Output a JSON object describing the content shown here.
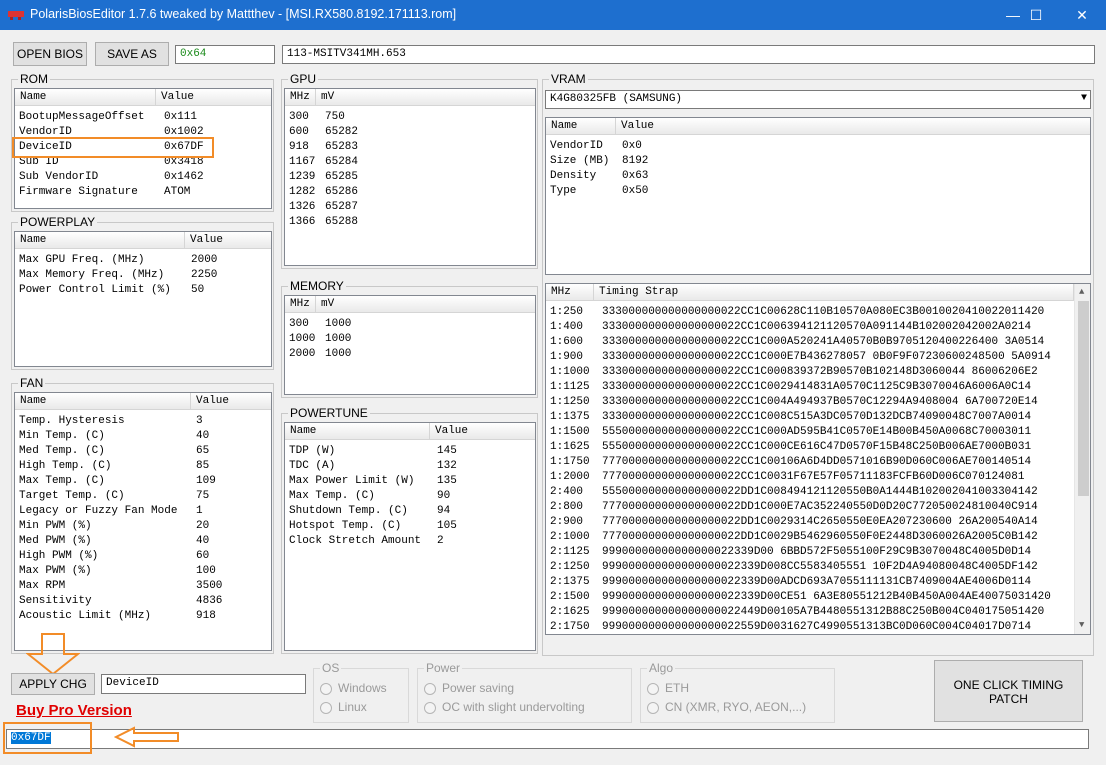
{
  "window": {
    "title": "PolarisBiosEditor 1.7.6 tweaked by Mattthev  -  [MSI.RX580.8192.171113.rom]",
    "minimize": "—",
    "maximize": "☐",
    "close": "✕"
  },
  "toolbar": {
    "open_label": "OPEN BIOS",
    "save_label": "SAVE AS",
    "checksum_value": "0x64",
    "part_number": "113-MSITV341MH.653"
  },
  "rom": {
    "label": "ROM",
    "col_name": "Name",
    "col_value": "Value",
    "rows": [
      {
        "name": "BootupMessageOffset",
        "value": "0x111"
      },
      {
        "name": "VendorID",
        "value": "0x1002"
      },
      {
        "name": "DeviceID",
        "value": "0x67DF"
      },
      {
        "name": "Sub ID",
        "value": "0x3418"
      },
      {
        "name": "Sub VendorID",
        "value": "0x1462"
      },
      {
        "name": "Firmware Signature",
        "value": "ATOM"
      }
    ]
  },
  "powerplay": {
    "label": "POWERPLAY",
    "col_name": "Name",
    "col_value": "Value",
    "rows": [
      {
        "name": "Max GPU Freq. (MHz)",
        "value": "2000"
      },
      {
        "name": "Max Memory Freq. (MHz)",
        "value": "2250"
      },
      {
        "name": "Power Control Limit (%)",
        "value": "50"
      }
    ]
  },
  "fan": {
    "label": "FAN",
    "col_name": "Name",
    "col_value": "Value",
    "rows": [
      {
        "name": "Temp. Hysteresis",
        "value": "3"
      },
      {
        "name": "Min Temp. (C)",
        "value": "40"
      },
      {
        "name": "Med Temp. (C)",
        "value": "65"
      },
      {
        "name": "High Temp. (C)",
        "value": "85"
      },
      {
        "name": "Max Temp. (C)",
        "value": "109"
      },
      {
        "name": "Target Temp. (C)",
        "value": "75"
      },
      {
        "name": "Legacy or Fuzzy Fan Mode",
        "value": "1"
      },
      {
        "name": "Min PWM (%)",
        "value": "20"
      },
      {
        "name": "Med PWM (%)",
        "value": "40"
      },
      {
        "name": "High PWM (%)",
        "value": "60"
      },
      {
        "name": "Max PWM (%)",
        "value": "100"
      },
      {
        "name": "Max RPM",
        "value": "3500"
      },
      {
        "name": "Sensitivity",
        "value": "4836"
      },
      {
        "name": "Acoustic Limit (MHz)",
        "value": "918"
      }
    ]
  },
  "gpu": {
    "label": "GPU",
    "col_mhz": "MHz",
    "col_mv": "mV",
    "rows": [
      {
        "mhz": "300",
        "mv": "750"
      },
      {
        "mhz": "600",
        "mv": "65282"
      },
      {
        "mhz": "918",
        "mv": "65283"
      },
      {
        "mhz": "1167",
        "mv": "65284"
      },
      {
        "mhz": "1239",
        "mv": "65285"
      },
      {
        "mhz": "1282",
        "mv": "65286"
      },
      {
        "mhz": "1326",
        "mv": "65287"
      },
      {
        "mhz": "1366",
        "mv": "65288"
      }
    ]
  },
  "memory": {
    "label": "MEMORY",
    "col_mhz": "MHz",
    "col_mv": "mV",
    "rows": [
      {
        "mhz": "300",
        "mv": "1000"
      },
      {
        "mhz": "1000",
        "mv": "1000"
      },
      {
        "mhz": "2000",
        "mv": "1000"
      }
    ]
  },
  "powertune": {
    "label": "POWERTUNE",
    "col_name": "Name",
    "col_value": "Value",
    "rows": [
      {
        "name": "TDP (W)",
        "value": "145"
      },
      {
        "name": "TDC (A)",
        "value": "132"
      },
      {
        "name": "Max Power Limit (W)",
        "value": "135"
      },
      {
        "name": "Max Temp. (C)",
        "value": "90"
      },
      {
        "name": "Shutdown Temp. (C)",
        "value": "94"
      },
      {
        "name": "Hotspot Temp. (C)",
        "value": "105"
      },
      {
        "name": "Clock Stretch Amount",
        "value": "2"
      }
    ]
  },
  "vram": {
    "label": "VRAM",
    "selected": "K4G80325FB (SAMSUNG)",
    "col_name": "Name",
    "col_value": "Value",
    "rows": [
      {
        "name": "VendorID",
        "value": "0x0"
      },
      {
        "name": "Size (MB)",
        "value": "8192"
      },
      {
        "name": "Density",
        "value": "0x63"
      },
      {
        "name": "Type",
        "value": "0x50"
      }
    ],
    "timing_col_mhz": "MHz",
    "timing_col_strap": "Timing Strap",
    "timings": [
      {
        "mhz": "1:250",
        "strap": "333000000000000000022CC1C00628C110B10570A080EC3B0010020410022011420"
      },
      {
        "mhz": "1:400",
        "strap": "333000000000000000022CC1C006394121120570A091144B102002042002A0214"
      },
      {
        "mhz": "1:600",
        "strap": "333000000000000000022CC1C000A520241A40570B0B9705120400226400 3A0514"
      },
      {
        "mhz": "1:900",
        "strap": "333000000000000000022CC1C000E7B436278057 0B0F9F07230600248500 5A0914"
      },
      {
        "mhz": "1:1000",
        "strap": "333000000000000000022CC1C000839372B90570B102148D3060044 86006206E2"
      },
      {
        "mhz": "1:1125",
        "strap": "333000000000000000022CC1C0029414831A0570C1125C9B3070046A6006A0C14"
      },
      {
        "mhz": "1:1250",
        "strap": "333000000000000000022CC1C004A494937B0570C12294A9408004 6A700720E14"
      },
      {
        "mhz": "1:1375",
        "strap": "333000000000000000022CC1C008C515A3DC0570D132DCB74090048C7007A0014"
      },
      {
        "mhz": "1:1500",
        "strap": "555000000000000000022CC1C000AD595B41C0570E14B00B450A0068C70003011"
      },
      {
        "mhz": "1:1625",
        "strap": "555000000000000000022CC1C000CE616C47D0570F15B48C250B006AE7000B031"
      },
      {
        "mhz": "1:1750",
        "strap": "777000000000000000022CC1C00106A6D4DD0571016B90D060C006AE700140514"
      },
      {
        "mhz": "1:2000",
        "strap": "777000000000000000022CC1C0031F67E57F05711183FCFB60D006C070124081"
      },
      {
        "mhz": "2:400",
        "strap": "555000000000000000022DD1C008494121120550B0A1444B102002041003304142"
      },
      {
        "mhz": "2:800",
        "strap": "777000000000000000022DD1C000E7AC352240550D0D20C772050024810040C914"
      },
      {
        "mhz": "2:900",
        "strap": "777000000000000000022DD1C0029314C2650550E0EA207230600 26A200540A14"
      },
      {
        "mhz": "2:1000",
        "strap": "777000000000000000022DD1C0029B5462960550F0E2448D3060026A2005C0B142"
      },
      {
        "mhz": "2:1125",
        "strap": "99900000000000000022339D00 6BBD572F5055100F29C9B3070048C4005D0D14"
      },
      {
        "mhz": "2:1250",
        "strap": "999000000000000000022339D008CC5583405551 10F2D4A94080048C4005DF142"
      },
      {
        "mhz": "2:1375",
        "strap": "999000000000000000022339D00ADCD693A7055111131CB7409004AE4006D0114"
      },
      {
        "mhz": "2:1500",
        "strap": "999000000000000000022339D00CE51 6A3E80551212B40B450A004AE40075031420"
      },
      {
        "mhz": "2:1625",
        "strap": "999000000000000000022449D00105A7B4480551312B88C250B004C040175051420"
      },
      {
        "mhz": "2:1750",
        "strap": "999000000000000000022559D0031627C4990551313BC0D060C004C04017D0714"
      }
    ]
  },
  "bottom": {
    "apply_label": "APPLY CHG",
    "edit_name": "DeviceID",
    "edit_value": "0x67DF",
    "buy_pro": "Buy Pro Version",
    "os_label": "OS",
    "os_windows": "Windows",
    "os_linux": "Linux",
    "power_label": "Power",
    "power_saving": "Power saving",
    "power_oc": "OC with slight undervolting",
    "algo_label": "Algo",
    "algo_eth": "ETH",
    "algo_cn": "CN (XMR, RYO, AEON,...)",
    "one_click_line1": "ONE CLICK TIMING",
    "one_click_line2": "PATCH"
  },
  "colors": {
    "titlebar": "#1e6fcf",
    "highlight_orange": "#f28c28",
    "buy_pro_red": "#e00000",
    "checksum_green": "#1a8a1a",
    "selection_blue": "#0078d7"
  }
}
